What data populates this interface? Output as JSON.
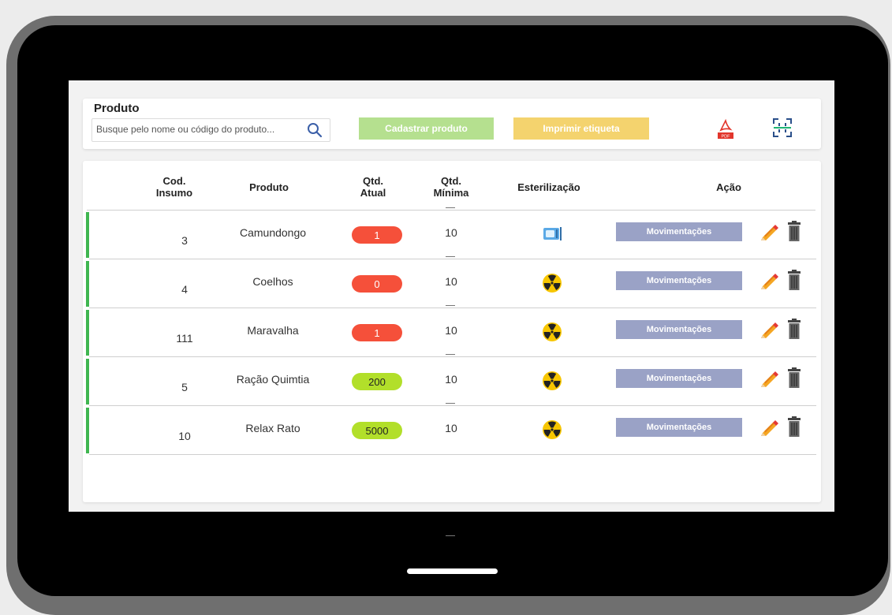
{
  "header": {
    "title": "Produto",
    "search_placeholder": "Busque pelo nome ou código do produto...",
    "buttons": {
      "cadastrar": "Cadastrar produto",
      "imprimir": "Imprimir etiqueta"
    },
    "icons": [
      "search-icon",
      "pdf-icon",
      "barcode-scan-icon"
    ]
  },
  "table": {
    "columns": {
      "cod_line1": "Cod.",
      "cod_line2": "Insumo",
      "produto": "Produto",
      "qtd_atual_line1": "Qtd.",
      "qtd_atual_line2": "Atual",
      "qtd_minima_line1": "Qtd.",
      "qtd_minima_line2": "Mínima",
      "esterilizacao": "Esterilização",
      "acao": "Ação"
    },
    "rows": [
      {
        "code": "3",
        "name": "Camundongo",
        "qty": "1",
        "qty_status": "low",
        "min": "10",
        "sterilization": "autoclave-icon",
        "action": "Movimentações"
      },
      {
        "code": "4",
        "name": "Coelhos",
        "qty": "0",
        "qty_status": "low",
        "min": "10",
        "sterilization": "radiation-icon",
        "action": "Movimentações"
      },
      {
        "code": "111",
        "name": "Maravalha",
        "qty": "1",
        "qty_status": "low",
        "min": "10",
        "sterilization": "radiation-icon",
        "action": "Movimentações"
      },
      {
        "code": "5",
        "name": "Ração Quimtia",
        "qty": "200",
        "qty_status": "ok",
        "min": "10",
        "sterilization": "radiation-icon",
        "action": "Movimentações"
      },
      {
        "code": "10",
        "name": "Relax Rato",
        "qty": "5000",
        "qty_status": "ok",
        "min": "10",
        "sterilization": "radiation-icon",
        "action": "Movimentações"
      }
    ]
  },
  "colors": {
    "accent_green": "#3fb650",
    "qty_low": "#f5503a",
    "qty_ok": "#b2df2a",
    "btn_cadastrar": "#b5e08f",
    "btn_imprimir": "#f4d36e",
    "btn_movimentacoes": "#9aa2c6"
  }
}
